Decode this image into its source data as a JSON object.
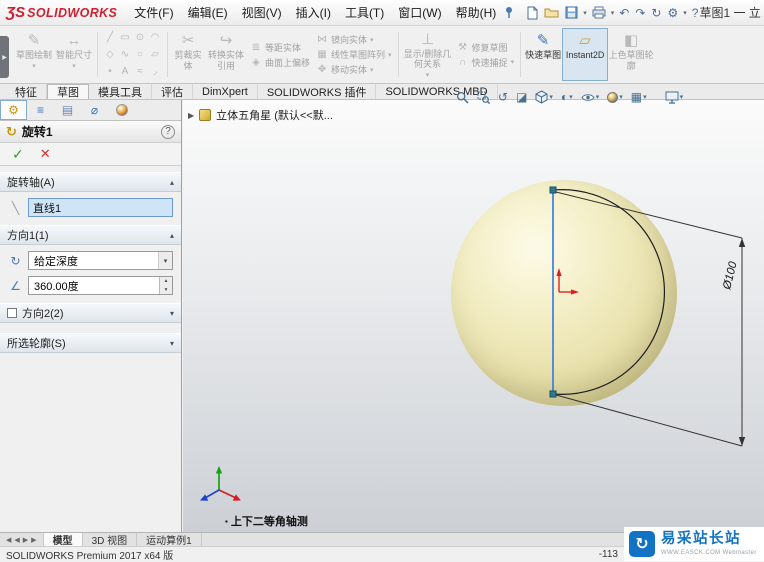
{
  "titlebar": {
    "logo": "ƷS",
    "brand": "SOLIDWORKS",
    "menus": [
      "文件(F)",
      "编辑(E)",
      "视图(V)",
      "插入(I)",
      "工具(T)",
      "窗口(W)",
      "帮助(H)"
    ],
    "doc_title": "草图1 一 立..."
  },
  "ribbon": {
    "sketch": "草图绘制",
    "smart_dim": "智能尺寸",
    "trim": "剪裁实体",
    "convert": "转换实体引用",
    "offset": "等距实体",
    "offset_surface": "曲面上偏移",
    "mirror": "镜向实体",
    "linear_pattern": "线性草图阵列",
    "move": "移动实体",
    "relations": "显示/删除几何关系",
    "repair": "修复草图",
    "snaps": "快速捕捉",
    "rapid_sketch": "快速草图",
    "instant2d": "Instant2D",
    "shaded_contours": "上色草图轮廓"
  },
  "tabs": [
    "特征",
    "草图",
    "模具工具",
    "评估",
    "DimXpert",
    "SOLIDWORKS 插件",
    "SOLIDWORKS MBD"
  ],
  "panel": {
    "title": "旋转1",
    "axis_section": "旋转轴(A)",
    "axis_value": "直线1",
    "dir1_section": "方向1(1)",
    "end_condition": "给定深度",
    "angle_value": "360.00度",
    "dir2_section": "方向2(2)",
    "contours_section": "所选轮廓(S)"
  },
  "viewport": {
    "breadcrumb": "立体五角星 (默认<<默...",
    "view_label": "上下二等角轴测",
    "dimension_label": "Ø100"
  },
  "bottom_tabs": [
    "模型",
    "3D 视图",
    "运动算例1"
  ],
  "statusbar": {
    "product": "SOLIDWORKS Premium 2017 x64 版",
    "coords": "-113"
  },
  "watermark": {
    "title": "易采站长站",
    "subtitle": "WWW.EASCK.COM Webmaster"
  },
  "icons": {
    "ok": "✓",
    "cancel": "✕",
    "help": "?",
    "pencil": "✎",
    "smart_dim": "↔",
    "trim": "✂",
    "convert": "↪",
    "offset": "≣",
    "offset_surface": "◈",
    "mirror": "⋈",
    "pattern": "▦",
    "move": "✥",
    "relations": "⊥",
    "repair": "⚒",
    "snaps": "∩",
    "rapid_sketch": "✎",
    "instant2d": "▱",
    "shaded": "◧",
    "grid": [
      "╱",
      "▭",
      "⊙",
      "◠",
      "◇",
      "∿",
      "○",
      "▱",
      "•",
      "A",
      "≈",
      "◞"
    ],
    "ptab_wrench": "⚙",
    "ptab_tree": "≡",
    "ptab_config": "▤",
    "ptab_dimx": "⌀",
    "axis_line": "╲",
    "revolve_dir": "↻",
    "angle": "∠",
    "revolve_feature": "↻",
    "prev_view": "↺",
    "section": "◪",
    "display_style": "◐",
    "scene": "▦",
    "undo": "↶",
    "redo": "↷",
    "rebuild": "↻",
    "gear": "⚙",
    "expand": "▶",
    "collapse": "▴",
    "caret": "▾",
    "nav_prev": "◀",
    "nav_next": "▶",
    "bullet": "▪",
    "wm_glyph": "↻"
  },
  "colors": {
    "brand_red": "#cf2030",
    "sphere": "#ece5b3",
    "selection": "#cfe4f7",
    "sketch_blue": "#3d7edb"
  }
}
